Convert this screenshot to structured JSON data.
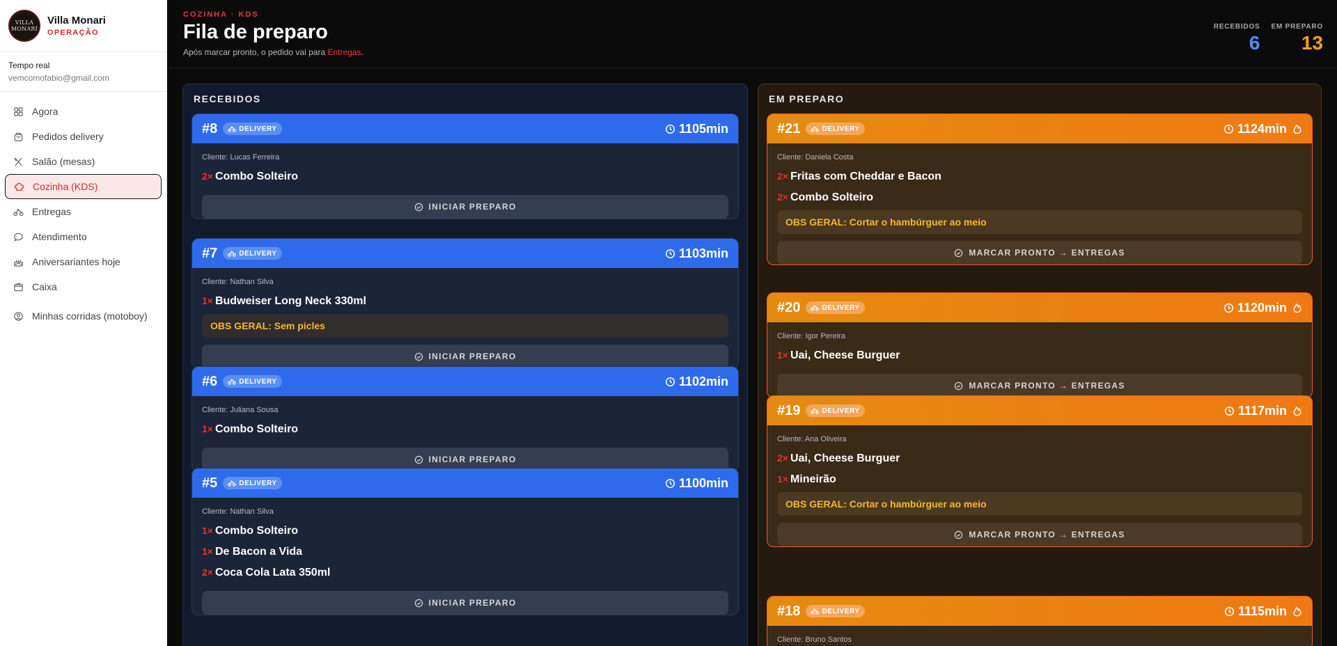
{
  "brand": {
    "logo_text": "VILLA MONARI",
    "name": "Villa Monari",
    "sub": "OPERAÇÃO"
  },
  "realtime": {
    "title": "Tempo real",
    "email": "vemcomofabio@gmail.com"
  },
  "nav": [
    {
      "label": "Agora",
      "icon": "grid-icon"
    },
    {
      "label": "Pedidos delivery",
      "icon": "bag-icon"
    },
    {
      "label": "Salão (mesas)",
      "icon": "utensils-icon"
    },
    {
      "label": "Cozinha (KDS)",
      "icon": "chef-hat-icon",
      "active": true
    },
    {
      "label": "Entregas",
      "icon": "bike-icon"
    },
    {
      "label": "Atendimento",
      "icon": "chat-icon"
    },
    {
      "label": "Aniversariantes hoje",
      "icon": "cake-icon"
    },
    {
      "label": "Caixa",
      "icon": "wallet-icon"
    },
    {
      "label": "Minhas corridas (motoboy)",
      "icon": "user-circle-icon"
    }
  ],
  "header": {
    "eyebrow": "COZINHA · KDS",
    "title": "Fila de preparo",
    "subtitle_pre": "Após marcar pronto, o pedido vai para ",
    "subtitle_link": "Entregas",
    "subtitle_post": "."
  },
  "stats": {
    "received_label": "RECEBIDOS",
    "received_value": "6",
    "received_color": "#4f8ef2",
    "preparing_label": "EM PREPARO",
    "preparing_value": "13",
    "preparing_color": "#f5a11c"
  },
  "columns": {
    "received": {
      "title": "RECEBIDOS",
      "button_label": "INICIAR PREPARO",
      "orders": [
        {
          "num": "#8",
          "tag": "DELIVERY",
          "time": "1105min",
          "client": "Cliente: Lucas Ferreira",
          "items": [
            {
              "qty": "2×",
              "name": "Combo Solteiro"
            }
          ]
        },
        {
          "num": "#7",
          "tag": "DELIVERY",
          "time": "1103min",
          "client": "Cliente: Nathan Silva",
          "items": [
            {
              "qty": "1×",
              "name": "Budweiser Long Neck 330ml"
            }
          ],
          "obs": "OBS GERAL: Sem picles"
        },
        {
          "num": "#6",
          "tag": "DELIVERY",
          "time": "1102min",
          "client": "Cliente: Juliana Sousa",
          "items": [
            {
              "qty": "1×",
              "name": "Combo Solteiro"
            }
          ]
        },
        {
          "num": "#5",
          "tag": "DELIVERY",
          "time": "1100min",
          "client": "Cliente: Nathan Silva",
          "items": [
            {
              "qty": "1×",
              "name": "Combo Solteiro"
            },
            {
              "qty": "1×",
              "name": "De Bacon a Vida"
            },
            {
              "qty": "2×",
              "name": "Coca Cola Lata 350ml"
            }
          ]
        }
      ]
    },
    "preparing": {
      "title": "EM PREPARO",
      "button_label": "MARCAR PRONTO → ENTREGAS",
      "orders": [
        {
          "num": "#21",
          "tag": "DELIVERY",
          "time": "1124min",
          "client": "Cliente: Daniela Costa",
          "items": [
            {
              "qty": "2×",
              "name": "Fritas com Cheddar e Bacon"
            },
            {
              "qty": "2×",
              "name": "Combo Solteiro"
            }
          ],
          "obs": "OBS GERAL: Cortar o hambúrguer ao meio"
        },
        {
          "num": "#20",
          "tag": "DELIVERY",
          "time": "1120min",
          "client": "Cliente: Igor Pereira",
          "items": [
            {
              "qty": "1×",
              "name": "Uai, Cheese Burguer"
            }
          ]
        },
        {
          "num": "#19",
          "tag": "DELIVERY",
          "time": "1117min",
          "client": "Cliente: Ana Oliveira",
          "items": [
            {
              "qty": "2×",
              "name": "Uai, Cheese Burguer"
            },
            {
              "qty": "1×",
              "name": "Mineirão"
            }
          ],
          "obs": "OBS GERAL: Cortar o hambúrguer ao meio"
        },
        {
          "num": "#18",
          "tag": "DELIVERY",
          "time": "1115min",
          "client": "Cliente: Bruno Santos",
          "items": []
        }
      ]
    }
  }
}
